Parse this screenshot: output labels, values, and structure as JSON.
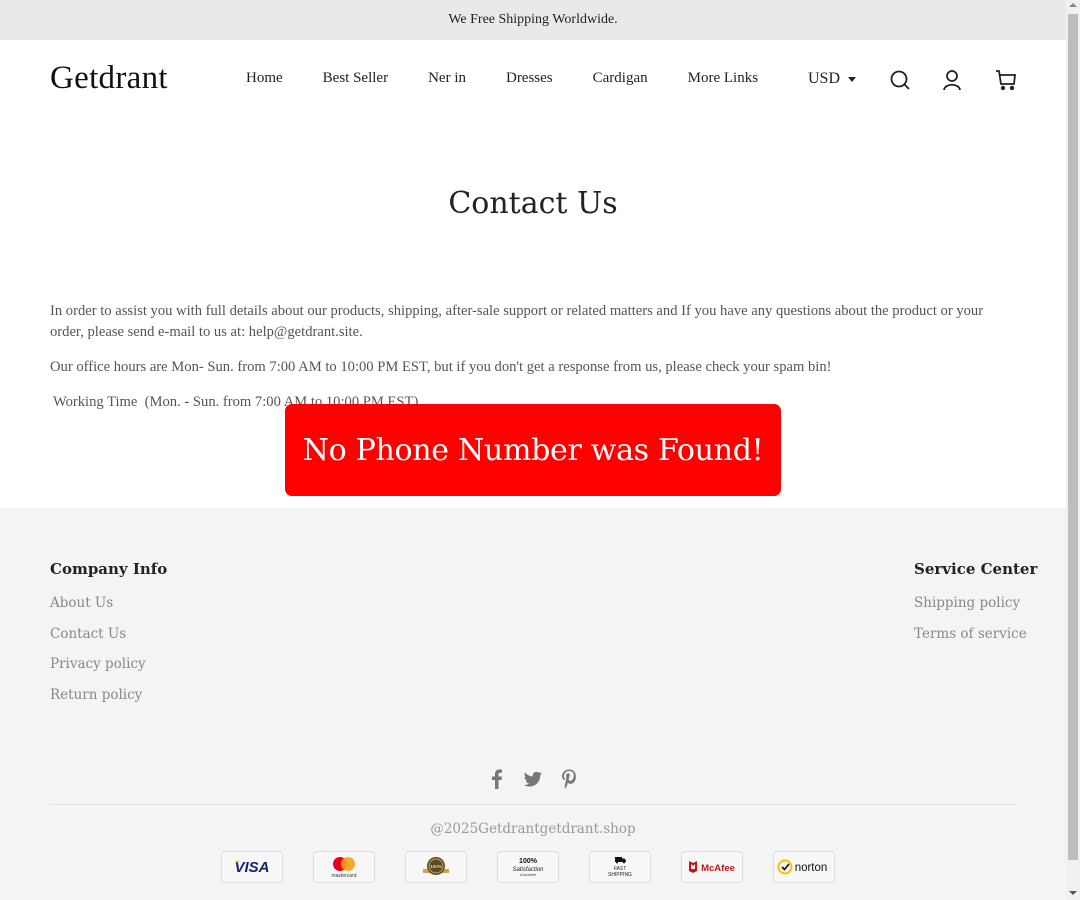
{
  "announcement": "We Free Shipping Worldwide.",
  "header": {
    "logo": "Getdrant",
    "nav": [
      {
        "label": "Home"
      },
      {
        "label": "Best Seller"
      },
      {
        "label": "Ner in"
      },
      {
        "label": "Dresses"
      },
      {
        "label": "Cardigan"
      },
      {
        "label": "More Links"
      }
    ],
    "currency": "USD",
    "icons": [
      "search-icon",
      "account-icon",
      "cart-icon"
    ]
  },
  "main": {
    "title": "Contact Us",
    "paragraph1": "In order to assist you with full details about our products, shipping, after-sale support or related matters and If you have any questions about the product or your order, please send e-mail to us at: help@getdrant.site.",
    "paragraph2": "Our office hours are Mon- Sun. from 7:00 AM to 10:00 PM EST, but if you don't get a response from us, please check your spam bin!",
    "paragraph3": "Working Time  (Mon. - Sun. from 7:00 AM to 10:00 PM EST)",
    "alert": "No Phone Number was Found!",
    "alert_color": "#ff0000"
  },
  "footer": {
    "company": {
      "heading": "Company Info",
      "links": [
        {
          "label": "About Us"
        },
        {
          "label": "Contact Us"
        },
        {
          "label": "Privacy policy"
        },
        {
          "label": "Return policy"
        }
      ]
    },
    "service": {
      "heading": "Service Center",
      "links": [
        {
          "label": "Shipping policy"
        },
        {
          "label": "Terms of service"
        }
      ]
    },
    "social": [
      "facebook-icon",
      "twitter-icon",
      "pinterest-icon"
    ],
    "copyright": "@2025Getdrantgetdrant.shop",
    "badges": [
      {
        "name": "visa",
        "text": "VISA"
      },
      {
        "name": "mastercard",
        "text": "mastercard"
      },
      {
        "name": "guarantee-seal",
        "text": "100%"
      },
      {
        "name": "satisfaction",
        "text": "100%",
        "sub": "Satisfaction",
        "sub2": "Guarantee"
      },
      {
        "name": "fast-shipping",
        "text": "FAST",
        "sub": "SHIPPING"
      },
      {
        "name": "mcafee",
        "text": "McAfee"
      },
      {
        "name": "norton",
        "text": "norton"
      }
    ]
  }
}
